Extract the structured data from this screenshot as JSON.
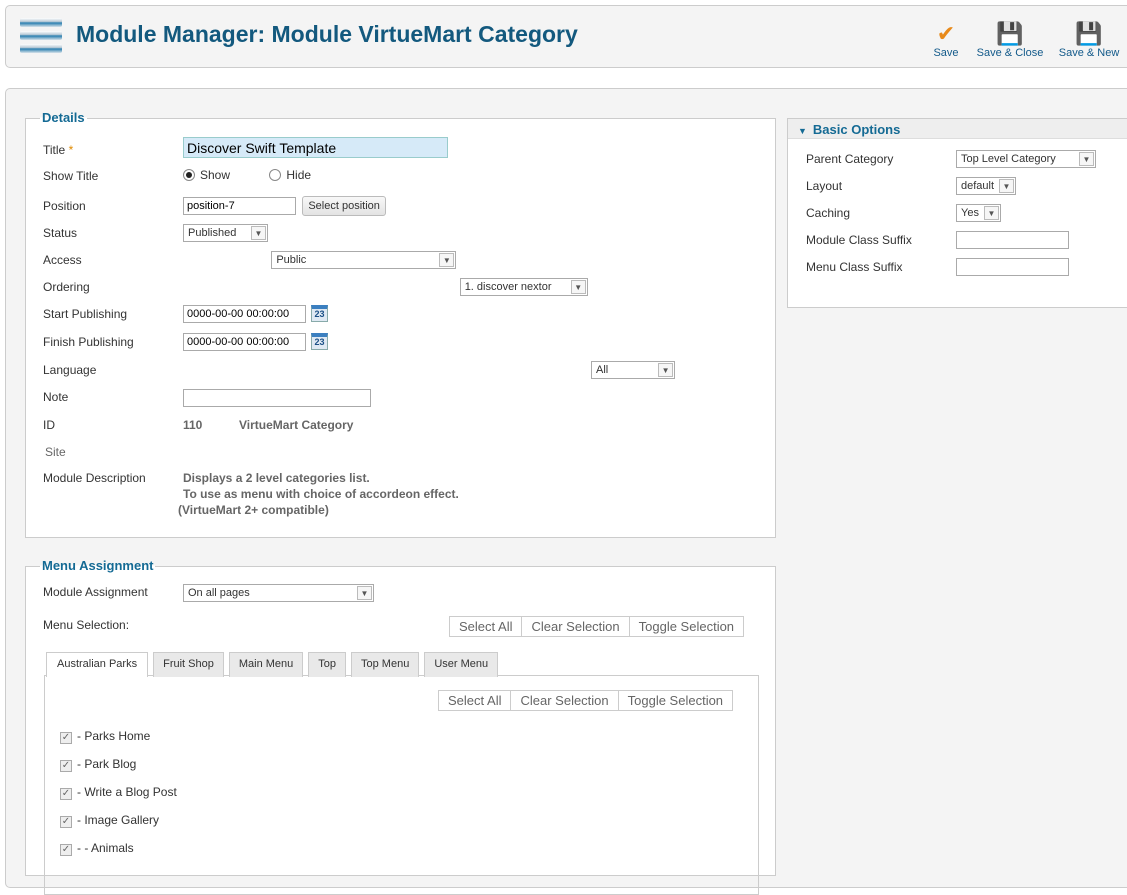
{
  "header": {
    "title": "Module Manager: Module VirtueMart Category",
    "toolbar": [
      {
        "label": "Save",
        "icon": "check-icon"
      },
      {
        "label": "Save & Close",
        "icon": "floppy-icon"
      },
      {
        "label": "Save & New",
        "icon": "floppy-plus-icon"
      }
    ]
  },
  "details": {
    "legend": "Details",
    "title_label": "Title",
    "required": "*",
    "title_value": "Discover Swift Template",
    "show_title_label": "Show Title",
    "show": "Show",
    "hide": "Hide",
    "position_label": "Position",
    "position_value": "position-7",
    "select_position": "Select position",
    "status_label": "Status",
    "status_value": "Published",
    "access_label": "Access",
    "access_value": "Public",
    "ordering_label": "Ordering",
    "ordering_value": "1. discover nextor",
    "start_label": "Start Publishing",
    "start_value": "0000-00-00 00:00:00",
    "finish_label": "Finish Publishing",
    "finish_value": "0000-00-00 00:00:00",
    "calendar_text": "23",
    "language_label": "Language",
    "language_value": "All",
    "note_label": "Note",
    "note_value": "",
    "id_label": "ID",
    "id_value": "110",
    "module_type": "VirtueMart Category",
    "site": "Site",
    "desc_label": "Module Description",
    "desc_lines": [
      "Displays a 2 level categories list.",
      "To use as menu with choice of accordeon effect.",
      "(VirtueMart 2+ compatible)"
    ]
  },
  "basic": {
    "legend": "Basic Options",
    "parent_label": "Parent Category",
    "parent_value": "Top Level Category",
    "layout_label": "Layout",
    "layout_value": "default",
    "caching_label": "Caching",
    "caching_value": "Yes",
    "mcs_label": "Module Class Suffix",
    "mcs_value": "",
    "menucs_label": "Menu Class Suffix",
    "menucs_value": ""
  },
  "menu": {
    "legend": "Menu Assignment",
    "assign_label": "Module Assignment",
    "assign_value": "On all pages",
    "selection_label": "Menu Selection:",
    "select_all": "Select All",
    "clear": "Clear Selection",
    "toggle": "Toggle Selection",
    "tabs": [
      "Australian Parks",
      "Fruit Shop",
      "Main Menu",
      "Top",
      "Top Menu",
      "User Menu"
    ],
    "items": [
      "- Parks Home",
      "- Park Blog",
      "- Write a Blog Post",
      "- Image Gallery",
      "- - Animals"
    ]
  }
}
